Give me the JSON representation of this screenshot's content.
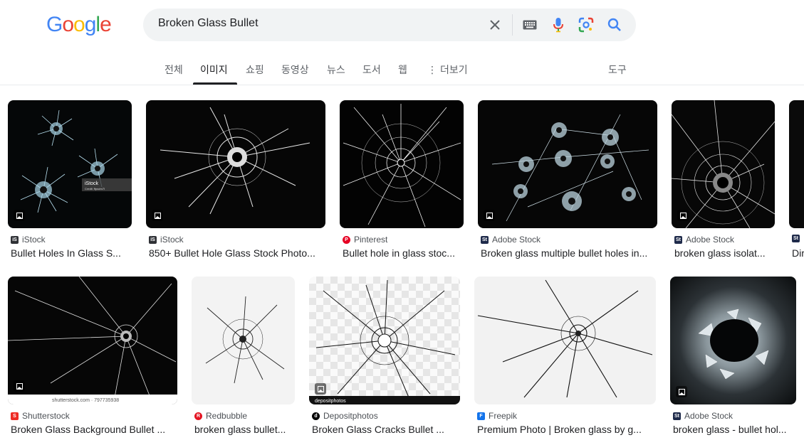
{
  "search": {
    "query": "Broken Glass Bullet"
  },
  "logo": {
    "letters": [
      "G",
      "o",
      "o",
      "g",
      "l",
      "e"
    ]
  },
  "tabs": [
    {
      "label": "전체"
    },
    {
      "label": "이미지"
    },
    {
      "label": "쇼핑"
    },
    {
      "label": "동영상"
    },
    {
      "label": "뉴스"
    },
    {
      "label": "도서"
    },
    {
      "label": "웹"
    },
    {
      "label": "더보기"
    },
    {
      "label": "도구"
    }
  ],
  "results": [
    {
      "source": "iStock",
      "title": "Bullet Holes In Glass S...",
      "watermark": "iStock",
      "credit": "Credit: ffpsdm7l"
    },
    {
      "source": "iStock",
      "title": "850+ Bullet Hole Glass Stock Photo..."
    },
    {
      "source": "Pinterest",
      "title": "Bullet hole in glass stoc..."
    },
    {
      "source": "Adobe Stock",
      "title": "Broken glass multiple bullet holes in..."
    },
    {
      "source": "Adobe Stock",
      "title": "broken glass isolat..."
    },
    {
      "source": "",
      "title": "Dir"
    },
    {
      "source": "Shutterstock",
      "title": "Broken Glass Background Bullet ...",
      "watermark": "shutterstock.com · 797735938"
    },
    {
      "source": "Redbubble",
      "title": "broken glass bullet..."
    },
    {
      "source": "Depositphotos",
      "title": "Broken Glass Cracks Bullet ...",
      "watermark": "depositphotos"
    },
    {
      "source": "Freepik",
      "title": "Premium Photo | Broken glass by g..."
    },
    {
      "source": "Adobe Stock",
      "title": "broken glass - bullet hol..."
    }
  ],
  "colors": {
    "google_blue": "#4285f4",
    "google_red": "#ea4335",
    "google_yellow": "#fbbc05",
    "google_green": "#34a853",
    "istock": "#2f3136",
    "pinterest": "#e60023",
    "adobe": "#1e2a4a",
    "shutterstock": "#ee2b24",
    "redbubble": "#e41321",
    "depositphotos": "#000000",
    "freepik": "#1273eb"
  }
}
